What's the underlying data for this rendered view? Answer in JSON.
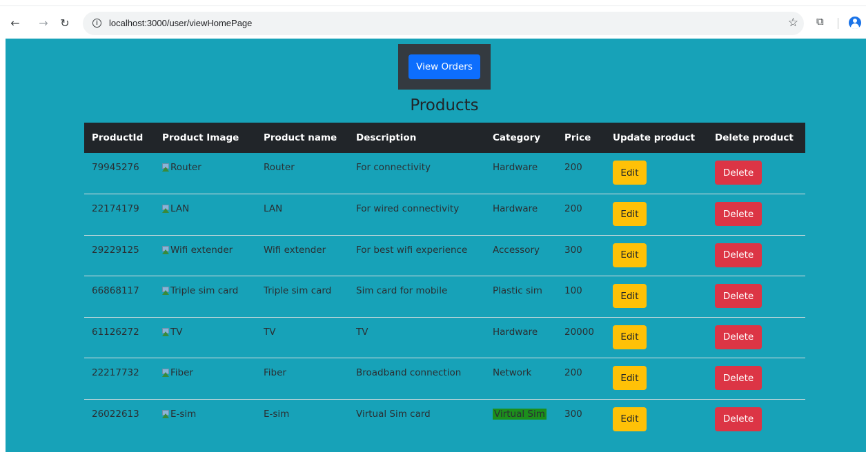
{
  "browser": {
    "url": "localhost:3000/user/viewHomePage",
    "back_icon": "back-arrow-icon",
    "forward_icon": "forward-arrow-icon",
    "reload_icon": "reload-icon"
  },
  "header": {
    "view_orders_label": "View Orders",
    "title": "Products"
  },
  "table": {
    "columns": [
      "ProductId",
      "Product Image",
      "Product name",
      "Description",
      "Category",
      "Price",
      "Update product",
      "Delete product"
    ],
    "rows": [
      {
        "id": "79945276",
        "image_alt": "Router",
        "name": "Router",
        "description": "For connectivity",
        "category": "Hardware",
        "price": "200",
        "edit": "Edit",
        "delete": "Delete"
      },
      {
        "id": "22174179",
        "image_alt": "LAN",
        "name": "LAN",
        "description": "For wired connectivity",
        "category": "Hardware",
        "price": "200",
        "edit": "Edit",
        "delete": "Delete"
      },
      {
        "id": "29229125",
        "image_alt": "Wifi extender",
        "name": "Wifi extender",
        "description": "For best wifi experience",
        "category": "Accessory",
        "price": "300",
        "edit": "Edit",
        "delete": "Delete"
      },
      {
        "id": "66868117",
        "image_alt": "Triple sim card",
        "name": "Triple sim card",
        "description": "Sim card for mobile",
        "category": "Plastic sim",
        "price": "100",
        "edit": "Edit",
        "delete": "Delete"
      },
      {
        "id": "61126272",
        "image_alt": "TV",
        "name": "TV",
        "description": "TV",
        "category": "Hardware",
        "price": "20000",
        "edit": "Edit",
        "delete": "Delete"
      },
      {
        "id": "22217732",
        "image_alt": "Fiber",
        "name": "Fiber",
        "description": "Broadband connection",
        "category": "Network",
        "price": "200",
        "edit": "Edit",
        "delete": "Delete"
      },
      {
        "id": "26022613",
        "image_alt": "E-sim",
        "name": "E-sim",
        "description": "Virtual Sim card",
        "category": "Virtual Sim",
        "price": "300",
        "edit": "Edit",
        "delete": "Delete"
      }
    ]
  },
  "colors": {
    "page_bg": "#17a2b8",
    "header_bg": "#212529",
    "orders_box_bg": "#343a40",
    "primary": "#0d6efd",
    "warning": "#ffc107",
    "danger": "#dc3545",
    "highlight": "#1c8f1c"
  }
}
